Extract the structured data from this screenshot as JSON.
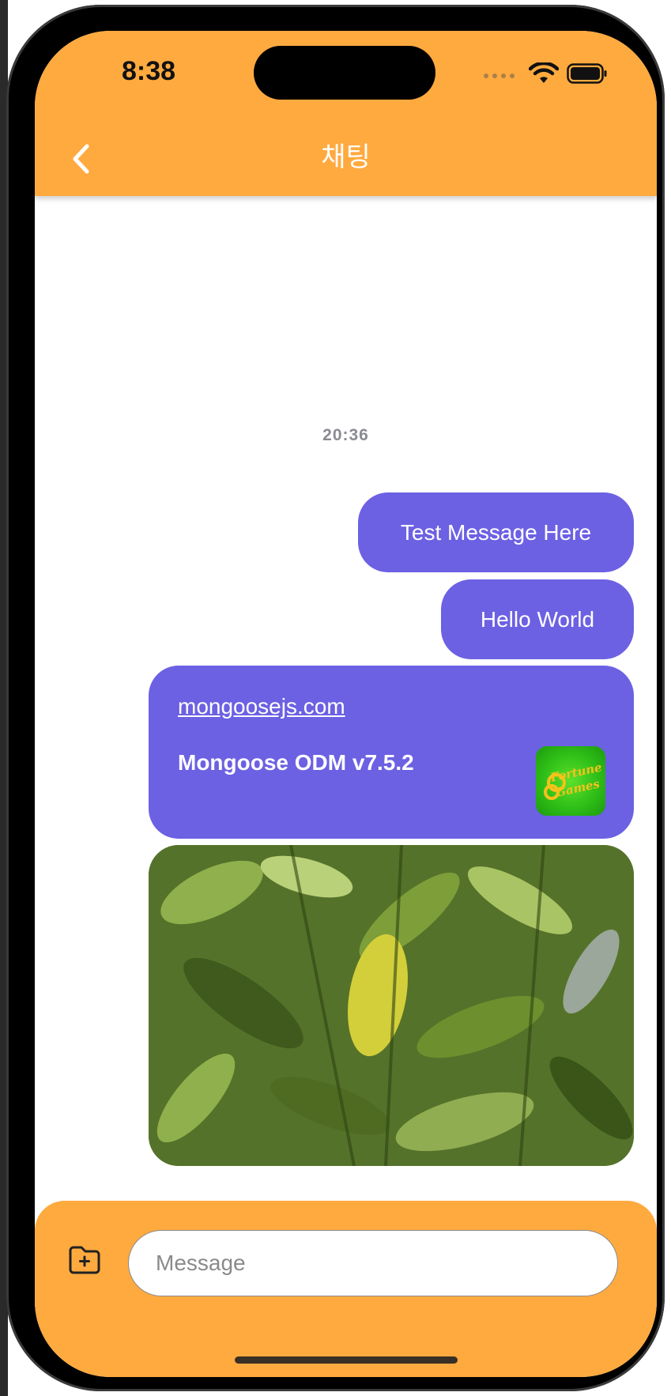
{
  "status_bar": {
    "time": "8:38"
  },
  "header": {
    "title": "채팅",
    "back_icon": "chevron-left-icon"
  },
  "chat": {
    "timestamp": "20:36",
    "messages": [
      {
        "type": "text",
        "text": "Test Message Here"
      },
      {
        "type": "text",
        "text": "Hello World"
      },
      {
        "type": "link",
        "url": "mongoosejs.com",
        "title": "Mongoose ODM v7.5.2",
        "thumbnail_text": "Fortune Games"
      },
      {
        "type": "image",
        "description_icon": "photo-icon"
      }
    ]
  },
  "composer": {
    "placeholder": "Message",
    "attach_icon": "folder-plus-icon"
  },
  "colors": {
    "accent": "#ffaa3f",
    "bubble": "#6c61e3",
    "timestamp": "#8a8a93"
  }
}
